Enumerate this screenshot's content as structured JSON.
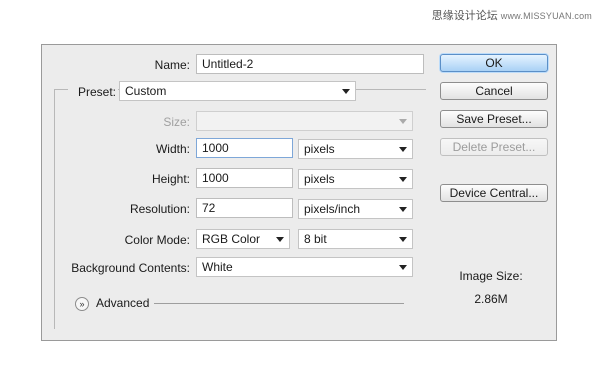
{
  "watermark": {
    "cn_text": "思缘设计论坛",
    "url": "www.MISSYUAN.com"
  },
  "name": {
    "label": "Name:",
    "value": "Untitled-2"
  },
  "preset": {
    "label": "Preset:",
    "value": "Custom"
  },
  "size": {
    "label": "Size:",
    "value": ""
  },
  "width": {
    "label": "Width:",
    "value": "1000",
    "unit": "pixels"
  },
  "height": {
    "label": "Height:",
    "value": "1000",
    "unit": "pixels"
  },
  "resolution": {
    "label": "Resolution:",
    "value": "72",
    "unit": "pixels/inch"
  },
  "color_mode": {
    "label": "Color Mode:",
    "value": "RGB Color",
    "depth": "8 bit"
  },
  "background": {
    "label": "Background Contents:",
    "value": "White"
  },
  "advanced": {
    "label": "Advanced",
    "icon": "double-chevron-down-icon"
  },
  "buttons": {
    "ok": "OK",
    "cancel": "Cancel",
    "save_preset": "Save Preset...",
    "delete_preset": "Delete Preset...",
    "device_central": "Device Central..."
  },
  "image_size": {
    "label": "Image Size:",
    "value": "2.86M"
  }
}
